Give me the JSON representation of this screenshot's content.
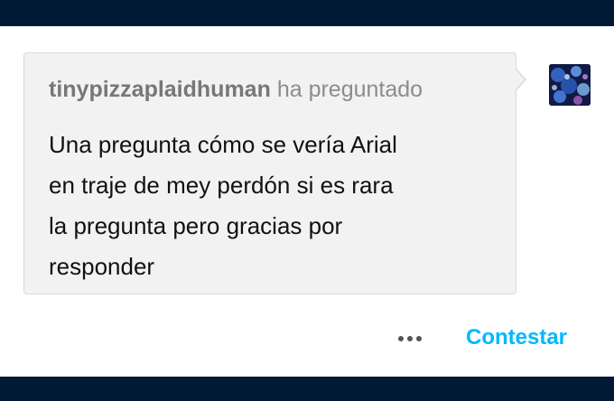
{
  "ask": {
    "asker": "tinypizzaplaidhuman",
    "action": "ha preguntado",
    "question_lines": [
      "Una pregunta cómo se vería Arial",
      "en traje de mey perdón si es rara",
      "la pregunta pero gracias por",
      "responder"
    ]
  },
  "avatar": {
    "icon": "blog-avatar"
  },
  "actions": {
    "more_icon": "ellipsis-icon",
    "answer_label": "Contestar"
  },
  "colors": {
    "bar": "#001935",
    "bubble": "#f2f2f2",
    "accent": "#00b8ff"
  }
}
